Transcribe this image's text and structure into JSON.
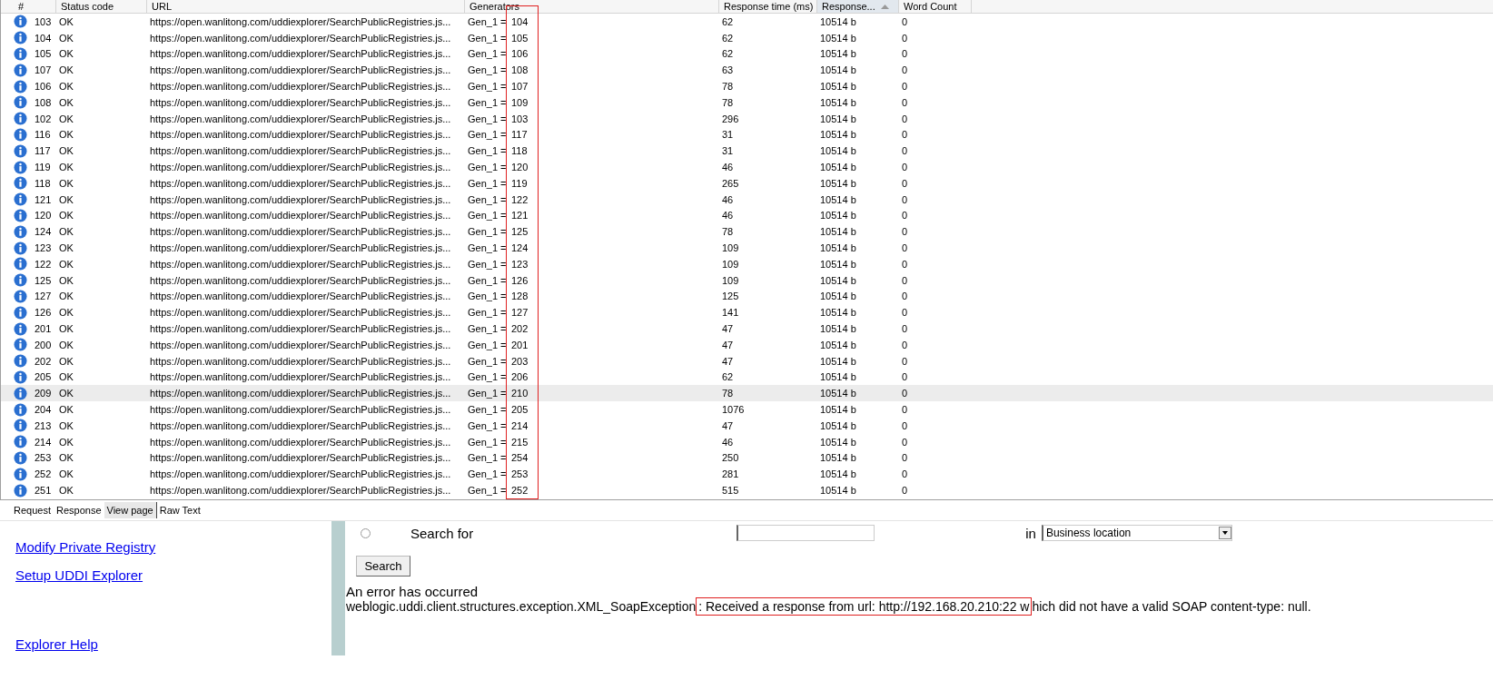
{
  "table": {
    "columns": [
      {
        "label": "#",
        "sorted": false
      },
      {
        "label": "Status code",
        "sorted": false
      },
      {
        "label": "URL",
        "sorted": false
      },
      {
        "label": "Generators",
        "sorted": false
      },
      {
        "label": "Response time (ms)",
        "sorted": false
      },
      {
        "label": "Response...",
        "sorted": true
      },
      {
        "label": "Word Count",
        "sorted": false
      }
    ],
    "rows": [
      {
        "num": "103",
        "status": "OK",
        "url": "https://open.wanlitong.com/uddiexplorer/SearchPublicRegistries.js...",
        "generator": "Gen_1 =",
        "generator_value": "104",
        "time": "62",
        "size": "10514 b",
        "words": "0",
        "selected": false
      },
      {
        "num": "104",
        "status": "OK",
        "url": "https://open.wanlitong.com/uddiexplorer/SearchPublicRegistries.js...",
        "generator": "Gen_1 =",
        "generator_value": "105",
        "time": "62",
        "size": "10514 b",
        "words": "0",
        "selected": false
      },
      {
        "num": "105",
        "status": "OK",
        "url": "https://open.wanlitong.com/uddiexplorer/SearchPublicRegistries.js...",
        "generator": "Gen_1 =",
        "generator_value": "106",
        "time": "62",
        "size": "10514 b",
        "words": "0",
        "selected": false
      },
      {
        "num": "107",
        "status": "OK",
        "url": "https://open.wanlitong.com/uddiexplorer/SearchPublicRegistries.js...",
        "generator": "Gen_1 =",
        "generator_value": "108",
        "time": "63",
        "size": "10514 b",
        "words": "0",
        "selected": false
      },
      {
        "num": "106",
        "status": "OK",
        "url": "https://open.wanlitong.com/uddiexplorer/SearchPublicRegistries.js...",
        "generator": "Gen_1 =",
        "generator_value": "107",
        "time": "78",
        "size": "10514 b",
        "words": "0",
        "selected": false
      },
      {
        "num": "108",
        "status": "OK",
        "url": "https://open.wanlitong.com/uddiexplorer/SearchPublicRegistries.js...",
        "generator": "Gen_1 =",
        "generator_value": "109",
        "time": "78",
        "size": "10514 b",
        "words": "0",
        "selected": false
      },
      {
        "num": "102",
        "status": "OK",
        "url": "https://open.wanlitong.com/uddiexplorer/SearchPublicRegistries.js...",
        "generator": "Gen_1 =",
        "generator_value": "103",
        "time": "296",
        "size": "10514 b",
        "words": "0",
        "selected": false
      },
      {
        "num": "116",
        "status": "OK",
        "url": "https://open.wanlitong.com/uddiexplorer/SearchPublicRegistries.js...",
        "generator": "Gen_1 =",
        "generator_value": "117",
        "time": "31",
        "size": "10514 b",
        "words": "0",
        "selected": false
      },
      {
        "num": "117",
        "status": "OK",
        "url": "https://open.wanlitong.com/uddiexplorer/SearchPublicRegistries.js...",
        "generator": "Gen_1 =",
        "generator_value": "118",
        "time": "31",
        "size": "10514 b",
        "words": "0",
        "selected": false
      },
      {
        "num": "119",
        "status": "OK",
        "url": "https://open.wanlitong.com/uddiexplorer/SearchPublicRegistries.js...",
        "generator": "Gen_1 =",
        "generator_value": "120",
        "time": "46",
        "size": "10514 b",
        "words": "0",
        "selected": false
      },
      {
        "num": "118",
        "status": "OK",
        "url": "https://open.wanlitong.com/uddiexplorer/SearchPublicRegistries.js...",
        "generator": "Gen_1 =",
        "generator_value": "119",
        "time": "265",
        "size": "10514 b",
        "words": "0",
        "selected": false
      },
      {
        "num": "121",
        "status": "OK",
        "url": "https://open.wanlitong.com/uddiexplorer/SearchPublicRegistries.js...",
        "generator": "Gen_1 =",
        "generator_value": "122",
        "time": "46",
        "size": "10514 b",
        "words": "0",
        "selected": false
      },
      {
        "num": "120",
        "status": "OK",
        "url": "https://open.wanlitong.com/uddiexplorer/SearchPublicRegistries.js...",
        "generator": "Gen_1 =",
        "generator_value": "121",
        "time": "46",
        "size": "10514 b",
        "words": "0",
        "selected": false
      },
      {
        "num": "124",
        "status": "OK",
        "url": "https://open.wanlitong.com/uddiexplorer/SearchPublicRegistries.js...",
        "generator": "Gen_1 =",
        "generator_value": "125",
        "time": "78",
        "size": "10514 b",
        "words": "0",
        "selected": false
      },
      {
        "num": "123",
        "status": "OK",
        "url": "https://open.wanlitong.com/uddiexplorer/SearchPublicRegistries.js...",
        "generator": "Gen_1 =",
        "generator_value": "124",
        "time": "109",
        "size": "10514 b",
        "words": "0",
        "selected": false
      },
      {
        "num": "122",
        "status": "OK",
        "url": "https://open.wanlitong.com/uddiexplorer/SearchPublicRegistries.js...",
        "generator": "Gen_1 =",
        "generator_value": "123",
        "time": "109",
        "size": "10514 b",
        "words": "0",
        "selected": false
      },
      {
        "num": "125",
        "status": "OK",
        "url": "https://open.wanlitong.com/uddiexplorer/SearchPublicRegistries.js...",
        "generator": "Gen_1 =",
        "generator_value": "126",
        "time": "109",
        "size": "10514 b",
        "words": "0",
        "selected": false
      },
      {
        "num": "127",
        "status": "OK",
        "url": "https://open.wanlitong.com/uddiexplorer/SearchPublicRegistries.js...",
        "generator": "Gen_1 =",
        "generator_value": "128",
        "time": "125",
        "size": "10514 b",
        "words": "0",
        "selected": false
      },
      {
        "num": "126",
        "status": "OK",
        "url": "https://open.wanlitong.com/uddiexplorer/SearchPublicRegistries.js...",
        "generator": "Gen_1 =",
        "generator_value": "127",
        "time": "141",
        "size": "10514 b",
        "words": "0",
        "selected": false
      },
      {
        "num": "201",
        "status": "OK",
        "url": "https://open.wanlitong.com/uddiexplorer/SearchPublicRegistries.js...",
        "generator": "Gen_1 =",
        "generator_value": "202",
        "time": "47",
        "size": "10514 b",
        "words": "0",
        "selected": false
      },
      {
        "num": "200",
        "status": "OK",
        "url": "https://open.wanlitong.com/uddiexplorer/SearchPublicRegistries.js...",
        "generator": "Gen_1 =",
        "generator_value": "201",
        "time": "47",
        "size": "10514 b",
        "words": "0",
        "selected": false
      },
      {
        "num": "202",
        "status": "OK",
        "url": "https://open.wanlitong.com/uddiexplorer/SearchPublicRegistries.js...",
        "generator": "Gen_1 =",
        "generator_value": "203",
        "time": "47",
        "size": "10514 b",
        "words": "0",
        "selected": false
      },
      {
        "num": "205",
        "status": "OK",
        "url": "https://open.wanlitong.com/uddiexplorer/SearchPublicRegistries.js...",
        "generator": "Gen_1 =",
        "generator_value": "206",
        "time": "62",
        "size": "10514 b",
        "words": "0",
        "selected": false
      },
      {
        "num": "209",
        "status": "OK",
        "url": "https://open.wanlitong.com/uddiexplorer/SearchPublicRegistries.js...",
        "generator": "Gen_1 =",
        "generator_value": "210",
        "time": "78",
        "size": "10514 b",
        "words": "0",
        "selected": true
      },
      {
        "num": "204",
        "status": "OK",
        "url": "https://open.wanlitong.com/uddiexplorer/SearchPublicRegistries.js...",
        "generator": "Gen_1 =",
        "generator_value": "205",
        "time": "1076",
        "size": "10514 b",
        "words": "0",
        "selected": false
      },
      {
        "num": "213",
        "status": "OK",
        "url": "https://open.wanlitong.com/uddiexplorer/SearchPublicRegistries.js...",
        "generator": "Gen_1 =",
        "generator_value": "214",
        "time": "47",
        "size": "10514 b",
        "words": "0",
        "selected": false
      },
      {
        "num": "214",
        "status": "OK",
        "url": "https://open.wanlitong.com/uddiexplorer/SearchPublicRegistries.js...",
        "generator": "Gen_1 =",
        "generator_value": "215",
        "time": "46",
        "size": "10514 b",
        "words": "0",
        "selected": false
      },
      {
        "num": "253",
        "status": "OK",
        "url": "https://open.wanlitong.com/uddiexplorer/SearchPublicRegistries.js...",
        "generator": "Gen_1 =",
        "generator_value": "254",
        "time": "250",
        "size": "10514 b",
        "words": "0",
        "selected": false
      },
      {
        "num": "252",
        "status": "OK",
        "url": "https://open.wanlitong.com/uddiexplorer/SearchPublicRegistries.js...",
        "generator": "Gen_1 =",
        "generator_value": "253",
        "time": "281",
        "size": "10514 b",
        "words": "0",
        "selected": false
      },
      {
        "num": "251",
        "status": "OK",
        "url": "https://open.wanlitong.com/uddiexplorer/SearchPublicRegistries.js...",
        "generator": "Gen_1 =",
        "generator_value": "252",
        "time": "515",
        "size": "10514 b",
        "words": "0",
        "selected": false
      }
    ]
  },
  "tabs": [
    {
      "label": "Request",
      "selected": false
    },
    {
      "label": "Response",
      "selected": false
    },
    {
      "label": "View page",
      "selected": true
    },
    {
      "label": "Raw Text",
      "selected": false
    }
  ],
  "page": {
    "nav_links": [
      "Modify Private Registry",
      "Setup UDDI Explorer",
      "Explorer Help"
    ],
    "search": {
      "radio_checked": false,
      "label": "Search for",
      "in_label": "in",
      "select_value": "Business location",
      "button": "Search"
    },
    "error_title": "An error has occurred",
    "error_message": {
      "prefix": "weblogic.uddi.client.structures.exception.XML_SoapException",
      "highlighted": ": Received a response from url: http://192.168.20.210:22 w",
      "suffix": "hich did not have a valid SOAP content-type: null."
    }
  }
}
